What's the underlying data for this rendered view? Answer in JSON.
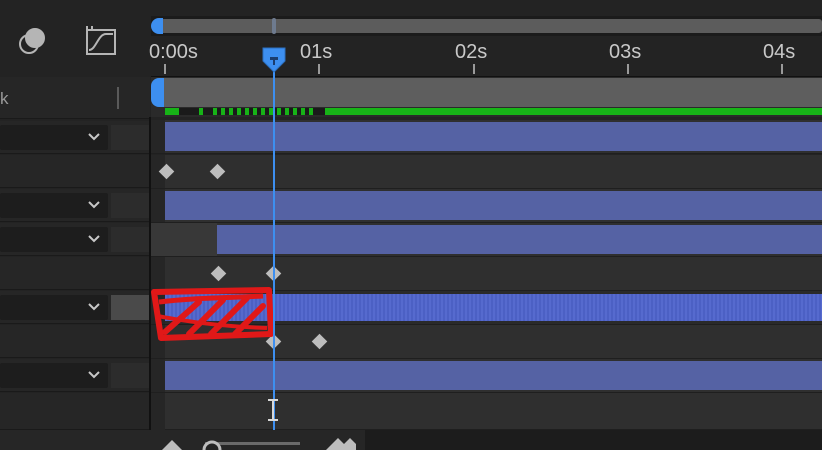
{
  "toolbar": {
    "icons": [
      "layers-icon",
      "graph-editor-icon"
    ]
  },
  "search": {
    "text": "k"
  },
  "ruler": {
    "labels": [
      "0:00s",
      "01s",
      "02s",
      "03s",
      "04s"
    ]
  },
  "colors": {
    "accent": "#3d8ff0",
    "layer_bar": "#5562a4",
    "selected_layer_bar": "#4f64cc",
    "cache": "#17b317",
    "annotation": "#e01818"
  }
}
